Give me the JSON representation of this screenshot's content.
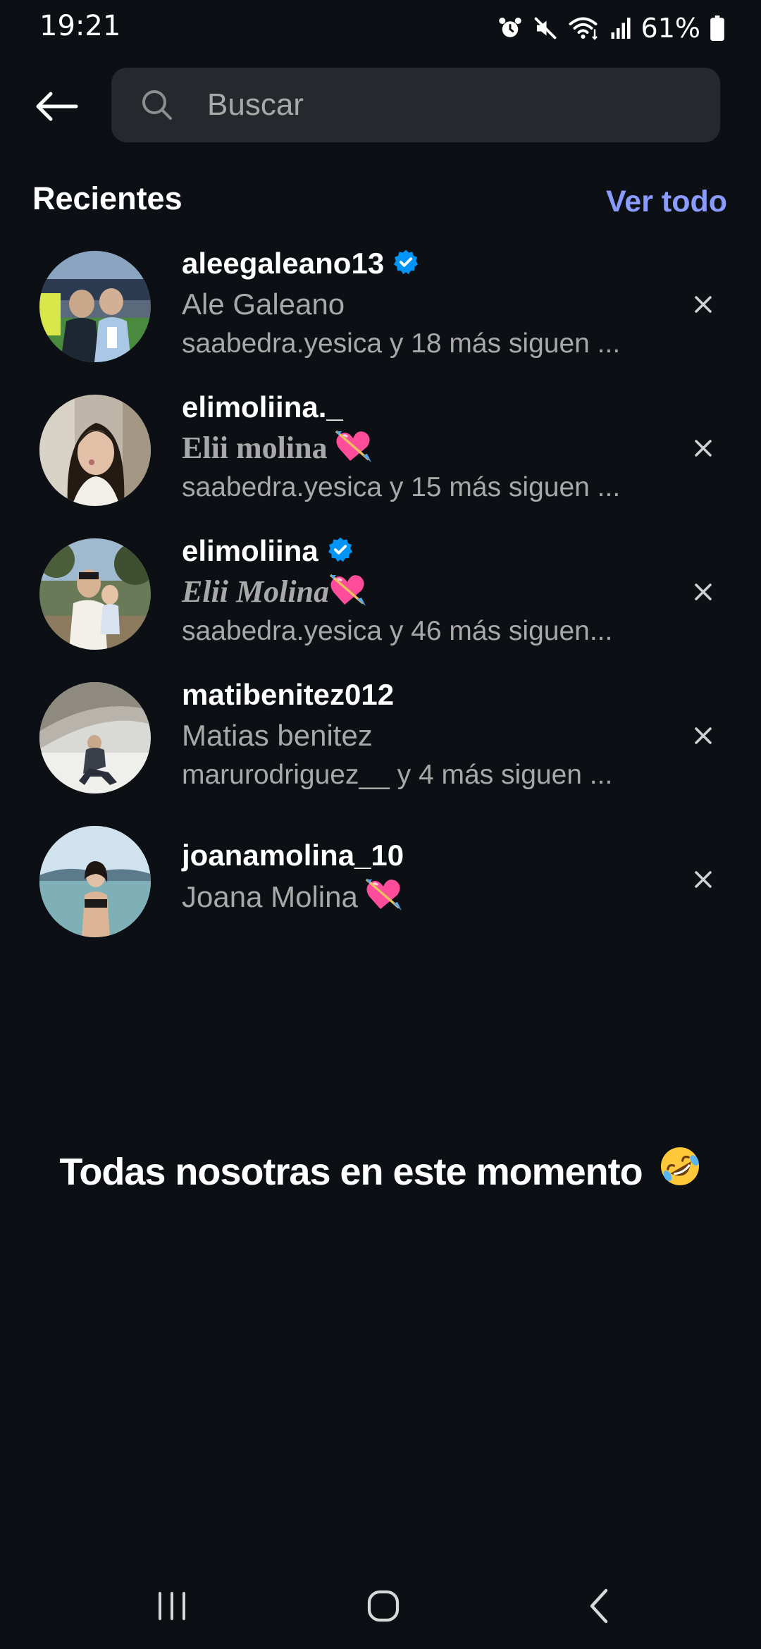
{
  "status_bar": {
    "time": "19:21",
    "battery": "61%",
    "icons": [
      "alarm-icon",
      "mute-icon",
      "wifi-icon",
      "signal-icon",
      "battery-icon"
    ]
  },
  "search": {
    "placeholder": "Buscar",
    "value": ""
  },
  "recents": {
    "title": "Recientes",
    "see_all": "Ver todo",
    "items": [
      {
        "username": "aleegaleano13",
        "verified": true,
        "name": "Ale Galeano",
        "followed_by": "saabedra.yesica y 18 más siguen ..."
      },
      {
        "username": "elimoliina._",
        "verified": false,
        "name": "Elii molina",
        "name_emoji": "heart-with-arrow",
        "followed_by": "saabedra.yesica y 15 más siguen ..."
      },
      {
        "username": "elimoliina",
        "verified": true,
        "name": "Elii Molina",
        "name_emoji": "heart-with-arrow",
        "followed_by": "saabedra.yesica y 46 más siguen..."
      },
      {
        "username": "matibenitez012",
        "verified": false,
        "name": "Matias benitez",
        "followed_by": "marurodriguez__ y 4 más siguen ..."
      },
      {
        "username": "joanamolina_10",
        "verified": false,
        "name": "Joana Molina",
        "name_emoji": "heart-with-arrow",
        "followed_by": ""
      }
    ]
  },
  "caption": {
    "text": "Todas nosotras en este momento",
    "emoji": "rolling-on-floor-laughing"
  },
  "colors": {
    "background": "#0c1014",
    "search_bg": "#25292e",
    "link": "#8a9bff",
    "verified": "#0095f6",
    "secondary_text": "#a8a8a8"
  }
}
